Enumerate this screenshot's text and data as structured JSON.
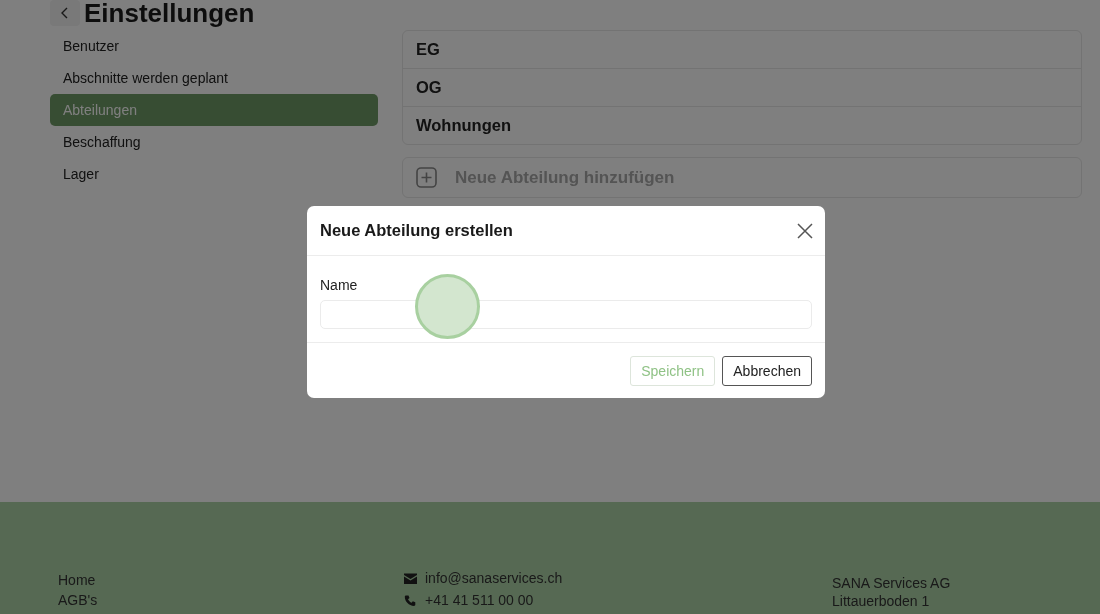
{
  "page": {
    "title": "Einstellungen"
  },
  "sidebar": {
    "items": [
      {
        "label": "Benutzer",
        "selected": false
      },
      {
        "label": "Abschnitte werden geplant",
        "selected": false
      },
      {
        "label": "Abteilungen",
        "selected": true
      },
      {
        "label": "Beschaffung",
        "selected": false
      },
      {
        "label": "Lager",
        "selected": false
      }
    ]
  },
  "departments": {
    "rows": [
      "EG",
      "OG",
      "Wohnungen"
    ],
    "add_label": "Neue Abteilung hinzufügen"
  },
  "dialog": {
    "title": "Neue Abteilung erstellen",
    "field": {
      "label": "Name"
    },
    "buttons": [
      {
        "label": "Speichern",
        "kind": "primary",
        "disabled": true
      },
      {
        "label": "Abbrechen",
        "kind": "secondary",
        "disabled": false
      }
    ]
  },
  "footer": {
    "links": [
      "Home",
      "AGB's"
    ],
    "contact": [
      {
        "kind": "email",
        "text": "info@sanaservices.ch"
      },
      {
        "kind": "phone",
        "text": "+41 41 511 00 00"
      }
    ],
    "address": [
      "SANA Services AG",
      "Littauerboden 1"
    ]
  }
}
